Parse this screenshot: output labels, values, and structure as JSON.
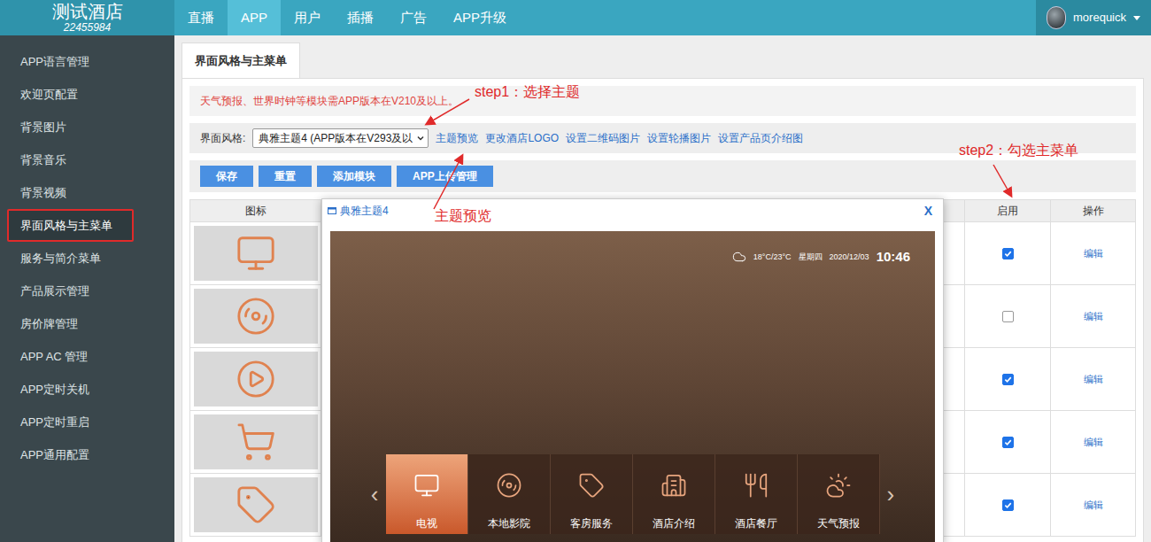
{
  "header": {
    "logo_title": "测试酒店",
    "logo_code": "22455984",
    "nav": [
      {
        "label": "直播",
        "selected": false
      },
      {
        "label": "APP",
        "selected": true
      },
      {
        "label": "用户",
        "selected": false
      },
      {
        "label": "插播",
        "selected": false
      },
      {
        "label": "广告",
        "selected": false
      },
      {
        "label": "APP升级",
        "selected": false
      }
    ],
    "user": {
      "name": "morequick"
    }
  },
  "sidebar": {
    "items": [
      {
        "label": "APP语言管理",
        "selected": false
      },
      {
        "label": "欢迎页配置",
        "selected": false
      },
      {
        "label": "背景图片",
        "selected": false
      },
      {
        "label": "背景音乐",
        "selected": false
      },
      {
        "label": "背景视频",
        "selected": false
      },
      {
        "label": "界面风格与主菜单",
        "selected": true
      },
      {
        "label": "服务与简介菜单",
        "selected": false
      },
      {
        "label": "产品展示管理",
        "selected": false
      },
      {
        "label": "房价牌管理",
        "selected": false
      },
      {
        "label": "APP AC 管理",
        "selected": false
      },
      {
        "label": "APP定时关机",
        "selected": false
      },
      {
        "label": "APP定时重启",
        "selected": false
      },
      {
        "label": "APP通用配置",
        "selected": false
      }
    ]
  },
  "page_tab": {
    "label": "界面风格与主菜单",
    "selected": true
  },
  "notice": "天气预报、世界时钟等模块需APP版本在V210及以上。",
  "style_row": {
    "label": "界面风格:",
    "select_value": "典雅主题4 (APP版本在V293及以",
    "links": [
      "主题预览",
      "更改酒店LOGO",
      "设置二维码图片",
      "设置轮播图片",
      "设置产品页介绍图"
    ]
  },
  "buttons": [
    "保存",
    "重置",
    "添加模块",
    "APP上传管理"
  ],
  "table": {
    "columns": [
      "图标",
      "启用",
      "操作"
    ],
    "rows": [
      {
        "enabled": true,
        "action": "编辑"
      },
      {
        "enabled": false,
        "action": "编辑"
      },
      {
        "enabled": true,
        "action": "编辑"
      },
      {
        "enabled": true,
        "action": "编辑"
      },
      {
        "enabled": true,
        "action": "编辑"
      }
    ]
  },
  "annotations": {
    "step1": "step1：选择主题",
    "preview": "主题预览",
    "step2": "step2：勾选主菜单"
  },
  "preview_dialog": {
    "title": "典雅主题4",
    "close": "X",
    "weather": {
      "temp": "18°C/23°C",
      "weekday": "星期四",
      "date": "2020/12/03",
      "time": "10:46"
    },
    "prev": "‹",
    "next": "›",
    "menu": [
      {
        "label": "电视",
        "selected": true
      },
      {
        "label": "本地影院",
        "selected": false
      },
      {
        "label": "客房服务",
        "selected": false
      },
      {
        "label": "酒店介绍",
        "selected": false
      },
      {
        "label": "酒店餐厅",
        "selected": false
      },
      {
        "label": "天气预报",
        "selected": false
      }
    ]
  }
}
